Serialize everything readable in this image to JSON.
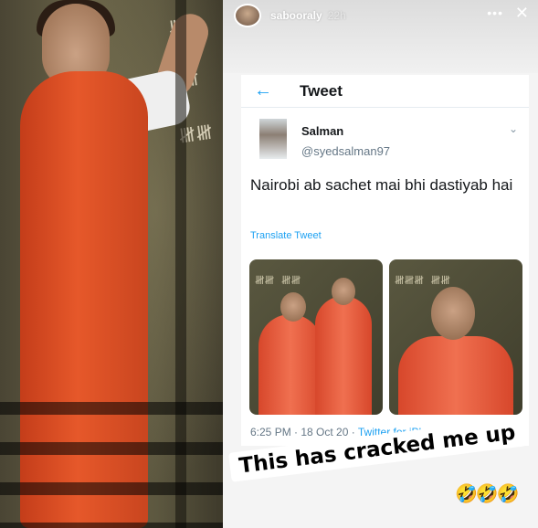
{
  "story": {
    "username": "sabooraly",
    "time_ago": "22h",
    "more_icon": "•••",
    "close_icon": "✕"
  },
  "tweet": {
    "header_title": "Tweet",
    "author_name": "Salman",
    "author_handle": "@syedsalman97",
    "text": "Nairobi ab sachet mai bhi dastiyab hai",
    "translate_label": "Translate Tweet",
    "time": "6:25 PM",
    "date": "18 Oct 20",
    "source": "Twitter for iPhone",
    "back_icon": "←",
    "chevron_icon": "⌄",
    "media_count": 2
  },
  "caption": {
    "text": "This has cracked me up",
    "emojis": "🤣🤣🤣"
  },
  "colors": {
    "twitter_blue": "#1da1f2",
    "jumpsuit_orange": "#e6582a",
    "muted_text": "#657786"
  }
}
